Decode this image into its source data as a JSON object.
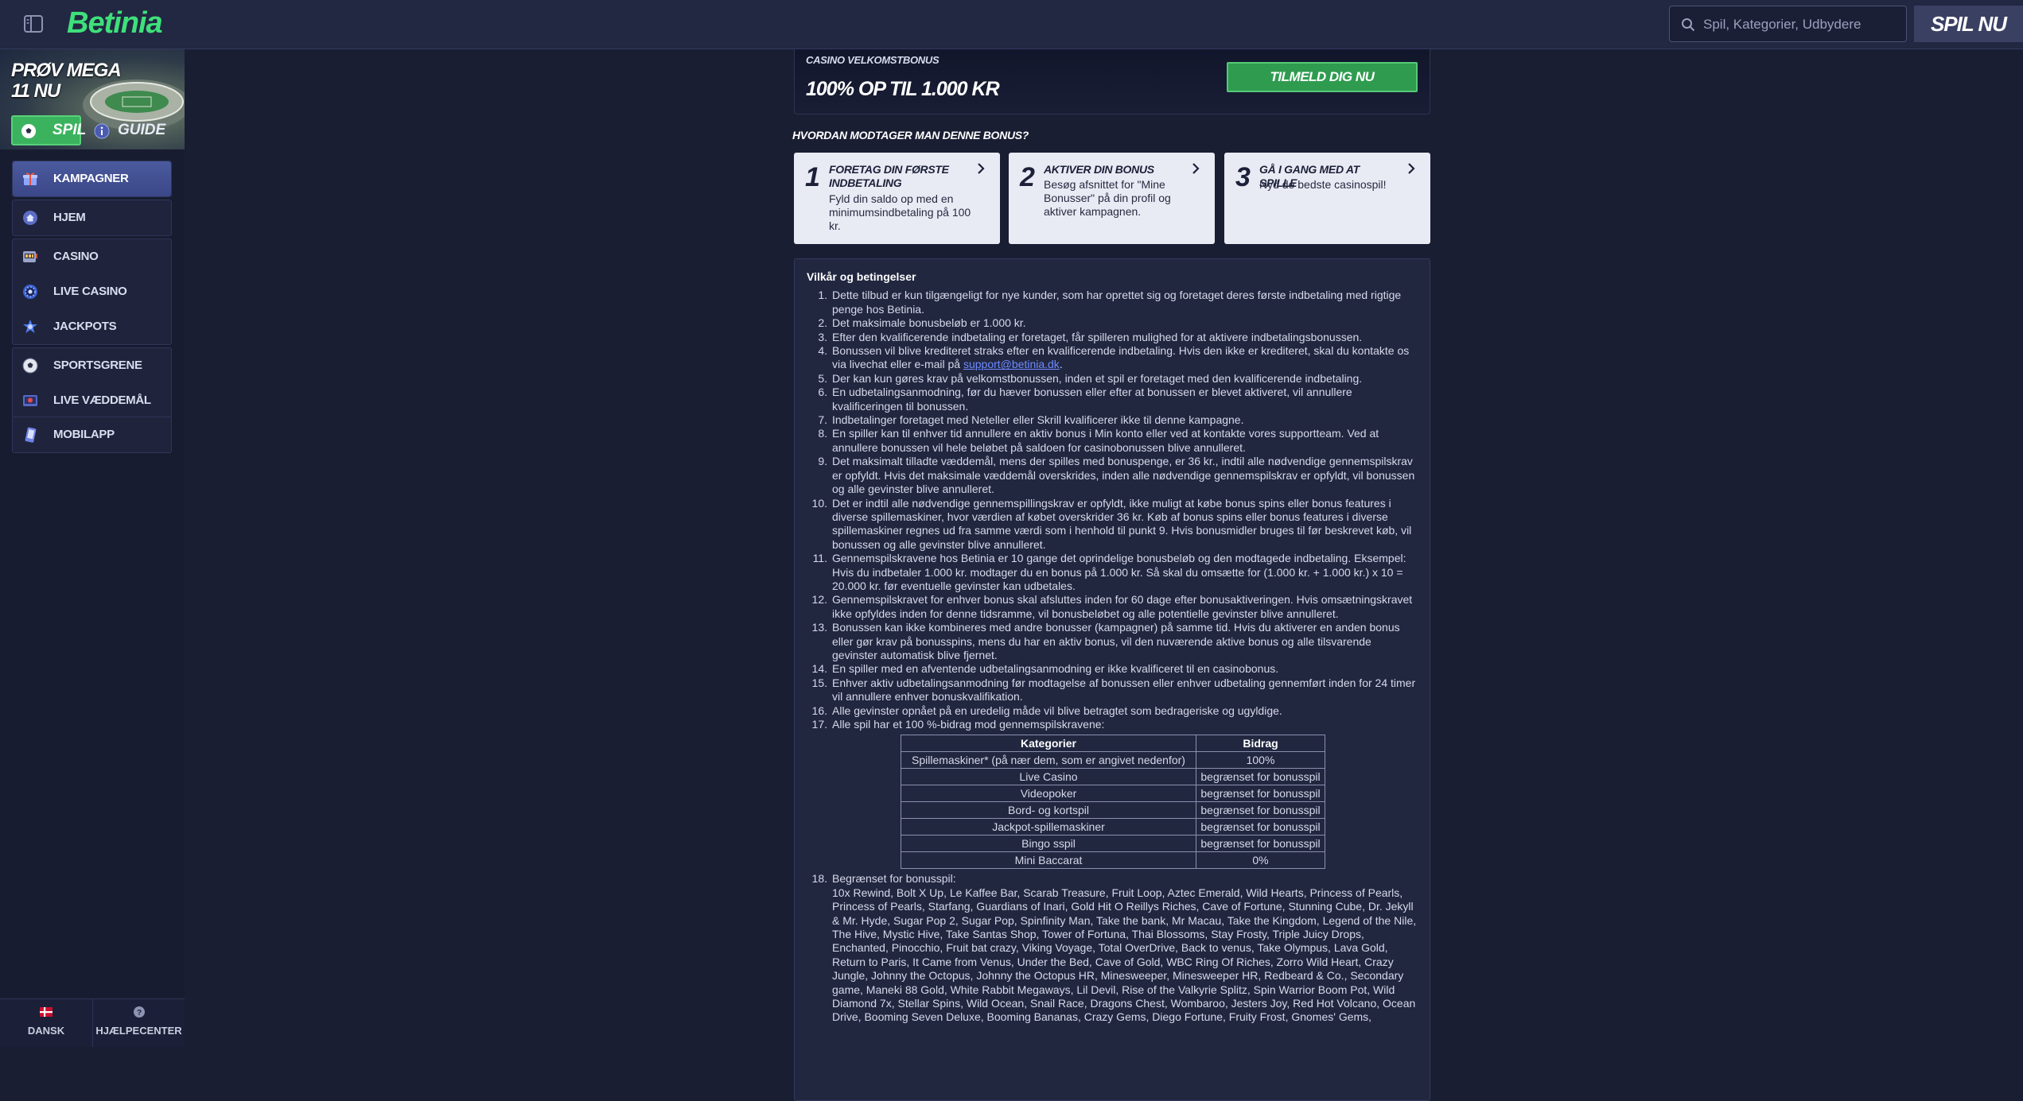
{
  "header": {
    "brand": "Betinia",
    "search_placeholder": "Spil, Kategorier, Udbydere",
    "play_now": "SPIL NU"
  },
  "sidebar": {
    "promo": {
      "title": "PRØV MEGA 11 NU",
      "play": "SPIL",
      "guide": "GUIDE"
    },
    "items": [
      {
        "label": "KAMPAGNER",
        "icon": "gift-icon",
        "active": true
      },
      {
        "label": "HJEM",
        "icon": "home-icon"
      },
      {
        "label": "CASINO",
        "icon": "slot-machine-icon"
      },
      {
        "label": "LIVE CASINO",
        "icon": "roulette-icon"
      },
      {
        "label": "JACKPOTS",
        "icon": "jackpot-icon"
      },
      {
        "label": "SPORTSGRENE",
        "icon": "football-icon"
      },
      {
        "label": "LIVE VÆDDEMÅL",
        "icon": "live-bet-icon"
      },
      {
        "label": "MOBILAPP",
        "icon": "mobile-icon"
      }
    ],
    "footer": {
      "language": "DANSK",
      "help": "HJÆLPECENTER"
    }
  },
  "bonus": {
    "label": "CASINO VELKOMSTBONUS",
    "amount": "100% OP TIL 1.000 KR",
    "signup": "TILMELD DIG NU",
    "how_heading": "HVORDAN MODTAGER MAN DENNE BONUS?"
  },
  "steps": [
    {
      "num": "1",
      "title": "FORETAG DIN FØRSTE INDBETALING",
      "desc": "Fyld din saldo op med en minimumsindbetaling på 100 kr."
    },
    {
      "num": "2",
      "title": "AKTIVER DIN BONUS",
      "desc": "Besøg afsnittet for \"Mine Bonusser\" på din profil og aktiver kampagnen."
    },
    {
      "num": "3",
      "title": "GÅ I GANG MED AT SPILLE",
      "desc": "Nyd de bedste casinospil!"
    }
  ],
  "terms": {
    "title": "Vilkår og betingelser",
    "items": [
      "Dette tilbud er kun tilgængeligt for nye kunder, som har oprettet sig og foretaget deres første indbetaling med rigtige penge hos Betinia.",
      "Det maksimale bonusbeløb er 1.000 kr.",
      "Efter den kvalificerende indbetaling er foretaget, får spilleren mulighed for at aktivere indbetalingsbonussen.",
      "Bonussen vil blive krediteret straks efter en kvalificerende indbetaling. Hvis den ikke er krediteret, skal du kontakte os via livechat eller e-mail på",
      "Der kan kun gøres krav på velkomstbonussen, inden et spil er foretaget med den kvalificerende indbetaling.",
      "En udbetalingsanmodning, før du hæver bonussen eller efter at bonussen er blevet aktiveret, vil annullere kvalificeringen til bonussen.",
      "Indbetalinger foretaget med Neteller eller Skrill kvalificerer ikke til denne kampagne.",
      "En spiller kan til enhver tid annullere en aktiv bonus i Min konto eller ved at kontakte vores supportteam. Ved at annullere bonussen vil hele beløbet på saldoen for casinobonussen blive annulleret.",
      "Det maksimalt tilladte væddemål, mens der spilles med bonuspenge, er 36 kr., indtil alle nødvendige gennemspilskrav er opfyldt. Hvis det maksimale væddemål overskrides, inden alle nødvendige gennemspilskrav er opfyldt, vil bonussen og alle gevinster blive annulleret.",
      "Det er indtil alle nødvendige gennemspillingskrav er opfyldt, ikke muligt at købe bonus spins eller bonus features i diverse spillemaskiner, hvor værdien af købet overskrider 36 kr. Køb af bonus spins eller bonus features i diverse spillemaskiner regnes ud fra samme værdi som i henhold til punkt 9. Hvis bonusmidler bruges til før beskrevet køb, vil bonussen og alle gevinster blive annulleret.",
      "Gennemspilskravene hos Betinia er 10 gange det oprindelige bonusbeløb og den modtagede indbetaling. Eksempel: Hvis du indbetaler 1.000 kr. modtager du en bonus på 1.000 kr. Så skal du omsætte for (1.000 kr. + 1.000 kr.) x 10 = 20.000 kr. før eventuelle gevinster kan udbetales.",
      "Gennemspilskravet for enhver bonus skal afsluttes inden for 60 dage efter bonusaktiveringen. Hvis omsætningskravet ikke opfyldes inden for denne tidsramme, vil bonusbeløbet og alle potentielle gevinster blive annulleret.",
      "Bonussen kan ikke kombineres med andre bonusser (kampagner) på samme tid. Hvis du aktiverer en anden bonus eller gør krav på bonusspins, mens du har en aktiv bonus, vil den nuværende aktive bonus og alle tilsvarende gevinster automatisk blive fjernet.",
      "En spiller med en afventende udbetalingsanmodning er ikke kvalificeret til en casinobonus.",
      "Enhver aktiv udbetalingsanmodning før modtagelse af bonussen eller enhver udbetaling gennemført inden for 24 timer vil annullere enhver bonuskvalifikation.",
      "Alle gevinster opnået på en uredelig måde vil blive betragtet som bedrageriske og ugyldige.",
      "Alle spil har et 100 %-bidrag mod gennemspilskravene:",
      "Begrænset for bonusspil:"
    ],
    "support_email": "support@betinia.dk",
    "table": {
      "headers": [
        "Kategorier",
        "Bidrag"
      ],
      "rows": [
        [
          "Spillemaskiner* (på nær dem, som er angivet nedenfor)",
          "100%"
        ],
        [
          "Live Casino",
          "begrænset for bonusspil"
        ],
        [
          "Videopoker",
          "begrænset for bonusspil"
        ],
        [
          "Bord- og kortspil",
          "begrænset for bonusspil"
        ],
        [
          "Jackpot-spillemaskiner",
          "begrænset for bonusspil"
        ],
        [
          "Bingo sspil",
          "begrænset for bonusspil"
        ],
        [
          "Mini Baccarat",
          "0%"
        ]
      ]
    },
    "restricted_games": "10x Rewind, Bolt X Up, Le Kaffee Bar, Scarab Treasure, Fruit Loop, Aztec Emerald, Wild Hearts, Princess of Pearls, Princess of Pearls, Starfang, Guardians of Inari, Gold Hit O Reillys Riches, Cave of Fortune, Stunning Cube, Dr. Jekyll & Mr. Hyde, Sugar Pop 2, Sugar Pop, Spinfinity Man, Take the bank, Mr Macau, Take the Kingdom, Legend of the Nile, The Hive, Mystic Hive, Take Santas Shop, Tower of Fortuna, Thai Blossoms, Stay Frosty, Triple Juicy Drops, Enchanted, Pinocchio, Fruit bat crazy, Viking Voyage, Total OverDrive, Back to venus, Take Olympus, Lava Gold, Return to Paris, It Came from Venus, Under the Bed, Cave of Gold, WBC Ring Of Riches, Zorro Wild Heart, Crazy Jungle, Johnny the Octopus, Johnny the Octopus HR, Minesweeper, Minesweeper HR, Redbeard & Co., Secondary game, Maneki 88 Gold, White Rabbit Megaways, Lil Devil, Rise of the Valkyrie Splitz, Spin Warrior Boom Pot, Wild Diamond 7x, Stellar Spins, Wild Ocean, Snail Race, Dragons Chest, Wombaroo, Jesters Joy, Red Hot Volcano, Ocean Drive, Booming Seven Deluxe, Booming Bananas, Crazy Gems, Diego Fortune, Fruity Frost, Gnomes' Gems,"
  }
}
